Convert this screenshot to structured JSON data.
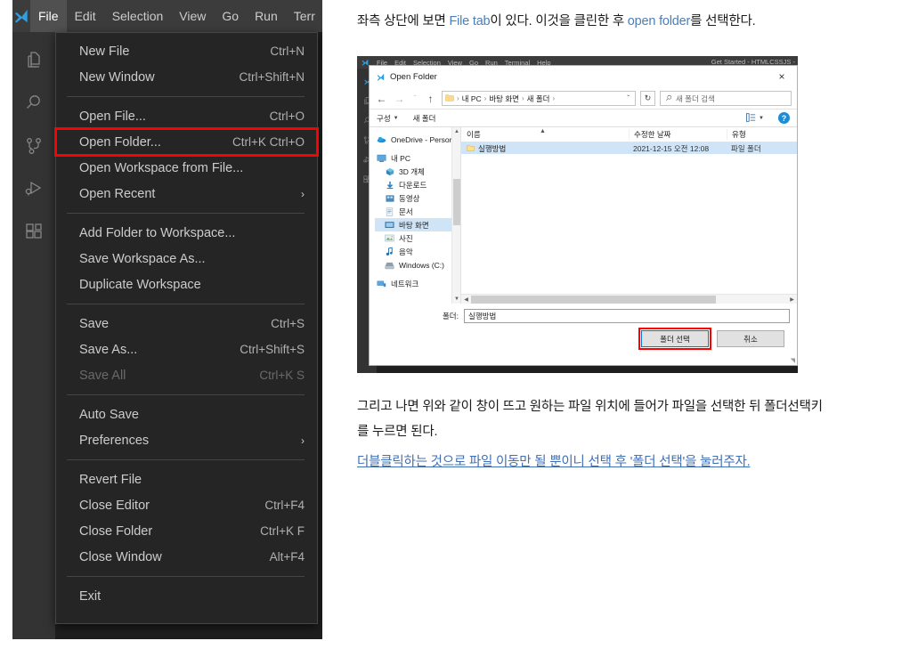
{
  "vscode": {
    "menubar": [
      "File",
      "Edit",
      "Selection",
      "View",
      "Go",
      "Run",
      "Terr"
    ],
    "activity_icons": [
      "explorer-icon",
      "search-icon",
      "source-control-icon",
      "run-and-debug-icon",
      "extensions-icon"
    ],
    "file_menu": [
      {
        "label": "New File",
        "key": "Ctrl+N"
      },
      {
        "label": "New Window",
        "key": "Ctrl+Shift+N"
      },
      {
        "sep": true
      },
      {
        "label": "Open File...",
        "key": "Ctrl+O"
      },
      {
        "label": "Open Folder...",
        "key": "Ctrl+K Ctrl+O",
        "highlight": true
      },
      {
        "label": "Open Workspace from File...",
        "key": ""
      },
      {
        "label": "Open Recent",
        "key": "",
        "arrow": "›"
      },
      {
        "sep": true
      },
      {
        "label": "Add Folder to Workspace...",
        "key": ""
      },
      {
        "label": "Save Workspace As...",
        "key": ""
      },
      {
        "label": "Duplicate Workspace",
        "key": ""
      },
      {
        "sep": true
      },
      {
        "label": "Save",
        "key": "Ctrl+S"
      },
      {
        "label": "Save As...",
        "key": "Ctrl+Shift+S"
      },
      {
        "label": "Save All",
        "key": "Ctrl+K S",
        "disabled": true
      },
      {
        "sep": true
      },
      {
        "label": "Auto Save",
        "key": ""
      },
      {
        "label": "Preferences",
        "key": "",
        "arrow": "›"
      },
      {
        "sep": true
      },
      {
        "label": "Revert File",
        "key": ""
      },
      {
        "label": "Close Editor",
        "key": "Ctrl+F4"
      },
      {
        "label": "Close Folder",
        "key": "Ctrl+K F"
      },
      {
        "label": "Close Window",
        "key": "Alt+F4"
      },
      {
        "sep": true
      },
      {
        "label": "Exit",
        "key": ""
      }
    ]
  },
  "article": {
    "p1_before": "좌측 상단에 보면 ",
    "p1_link1": "File tab",
    "p1_mid": "이 있다. 이것을 클린한 후 ",
    "p1_link2": "open folder",
    "p1_after": "를 선택한다.",
    "p2_line1": "그리고 나면 위와 같이 창이 뜨고 원하는 파일 위치에 들어가 파일을 선택한 뒤 폴더선택키",
    "p2_line2": "를 누르면 된다.",
    "p3_link": "더블클릭하는 것으로 파일 이동만 될 뿐이니 선택 후 '폴더 선택'을 눌러주자."
  },
  "embed": {
    "vs_menubar": [
      "File",
      "Edit",
      "Selection",
      "View",
      "Go",
      "Run",
      "Terminal",
      "Help"
    ],
    "vs_window_title": "Get Started - HTMLCSSJS -",
    "dialog": {
      "title": "Open Folder",
      "close_glyph": "×",
      "nav": {
        "back": "←",
        "forward": "→",
        "recent": "ˇ",
        "up": "↑"
      },
      "breadcrumbs": [
        "내 PC",
        "바탕 화면",
        "새 폴더"
      ],
      "breadcrumb_caret": "ˇ",
      "refresh_glyph": "↻",
      "search_placeholder": "새 폴더 검색",
      "toolbar": {
        "organize": "구성",
        "new_folder": "새 폴더",
        "help": "?"
      },
      "sidebar": [
        {
          "label": "OneDrive - Persor",
          "icon": "onedrive-icon",
          "indent": false
        },
        {
          "label": "내 PC",
          "icon": "this-pc-icon",
          "indent": false,
          "gap_before": true
        },
        {
          "label": "3D 개체",
          "icon": "3d-objects-icon",
          "indent": true
        },
        {
          "label": "다운로드",
          "icon": "downloads-icon",
          "indent": true
        },
        {
          "label": "동영상",
          "icon": "videos-icon",
          "indent": true
        },
        {
          "label": "문서",
          "icon": "documents-icon",
          "indent": true
        },
        {
          "label": "바탕 화면",
          "icon": "desktop-icon",
          "indent": true,
          "selected": true
        },
        {
          "label": "사진",
          "icon": "pictures-icon",
          "indent": true
        },
        {
          "label": "음악",
          "icon": "music-icon",
          "indent": true
        },
        {
          "label": "Windows (C:)",
          "icon": "drive-icon",
          "indent": true
        },
        {
          "label": "네트워크",
          "icon": "network-icon",
          "indent": false,
          "gap_before": true
        }
      ],
      "columns": [
        "이름",
        "수정한 날짜",
        "유형"
      ],
      "rows": [
        {
          "name": "실행방법",
          "modified": "2021-12-15 오전 12:08",
          "type": "파일 폴더",
          "selected": true
        }
      ],
      "folder_label": "폴더:",
      "folder_value": "실행방법",
      "select_button": "폴더 선택",
      "cancel_button": "취소"
    }
  },
  "colors": {
    "highlight_red": "#ff0000",
    "link_blue": "#4a7ebb",
    "selection_blue": "#cfe4f7",
    "vscode_bg": "#1e1e1e",
    "vscode_menu_bg": "#252526",
    "vscode_titlebar": "#3c3c3c"
  }
}
